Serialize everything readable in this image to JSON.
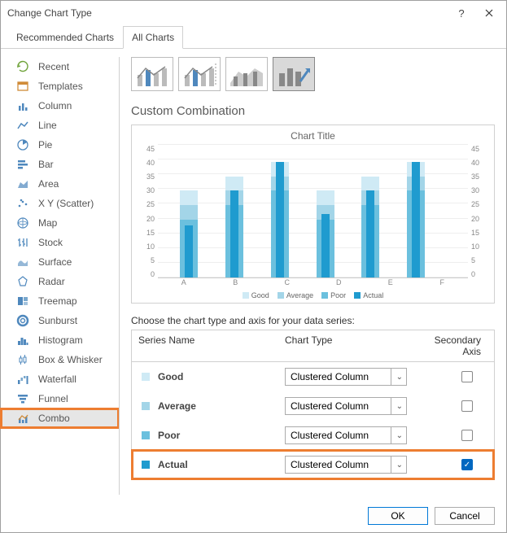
{
  "window": {
    "title": "Change Chart Type"
  },
  "tabs": {
    "recommended": "Recommended Charts",
    "all": "All Charts"
  },
  "sidebar": {
    "items": [
      {
        "label": "Recent"
      },
      {
        "label": "Templates"
      },
      {
        "label": "Column"
      },
      {
        "label": "Line"
      },
      {
        "label": "Pie"
      },
      {
        "label": "Bar"
      },
      {
        "label": "Area"
      },
      {
        "label": "X Y (Scatter)"
      },
      {
        "label": "Map"
      },
      {
        "label": "Stock"
      },
      {
        "label": "Surface"
      },
      {
        "label": "Radar"
      },
      {
        "label": "Treemap"
      },
      {
        "label": "Sunburst"
      },
      {
        "label": "Histogram"
      },
      {
        "label": "Box & Whisker"
      },
      {
        "label": "Waterfall"
      },
      {
        "label": "Funnel"
      },
      {
        "label": "Combo"
      }
    ]
  },
  "section_title": "Custom Combination",
  "chart_data": {
    "type": "bar",
    "title": "Chart Title",
    "categories": [
      "A",
      "B",
      "C",
      "D",
      "E",
      "F"
    ],
    "ylim": [
      0,
      45
    ],
    "yticks": [
      0,
      5,
      10,
      15,
      20,
      25,
      30,
      35,
      40,
      45
    ],
    "series": [
      {
        "name": "Good",
        "values": [
          30,
          35,
          40,
          30,
          35,
          40
        ],
        "color": "#cfeaf5",
        "stacked": true
      },
      {
        "name": "Average",
        "values": [
          25,
          30,
          35,
          25,
          30,
          35
        ],
        "color": "#a3d5e8",
        "stacked": true
      },
      {
        "name": "Poor",
        "values": [
          20,
          25,
          30,
          20,
          25,
          30
        ],
        "color": "#6bc0de",
        "stacked": true
      },
      {
        "name": "Actual",
        "values": [
          18,
          30,
          40,
          22,
          30,
          40
        ],
        "color": "#1f9bcf",
        "secondary_axis": true
      }
    ],
    "legend": [
      "Good",
      "Average",
      "Poor",
      "Actual"
    ]
  },
  "series_caption": "Choose the chart type and axis for your data series:",
  "series_table": {
    "headers": {
      "name": "Series Name",
      "type": "Chart Type",
      "axis": "Secondary Axis"
    },
    "rows": [
      {
        "name": "Good",
        "color": "#cfeaf5",
        "chart_type": "Clustered Column",
        "secondary": false
      },
      {
        "name": "Average",
        "color": "#a3d5e8",
        "chart_type": "Clustered Column",
        "secondary": false
      },
      {
        "name": "Poor",
        "color": "#6bc0de",
        "chart_type": "Clustered Column",
        "secondary": false
      },
      {
        "name": "Actual",
        "color": "#1f9bcf",
        "chart_type": "Clustered Column",
        "secondary": true
      }
    ]
  },
  "buttons": {
    "ok": "OK",
    "cancel": "Cancel"
  }
}
